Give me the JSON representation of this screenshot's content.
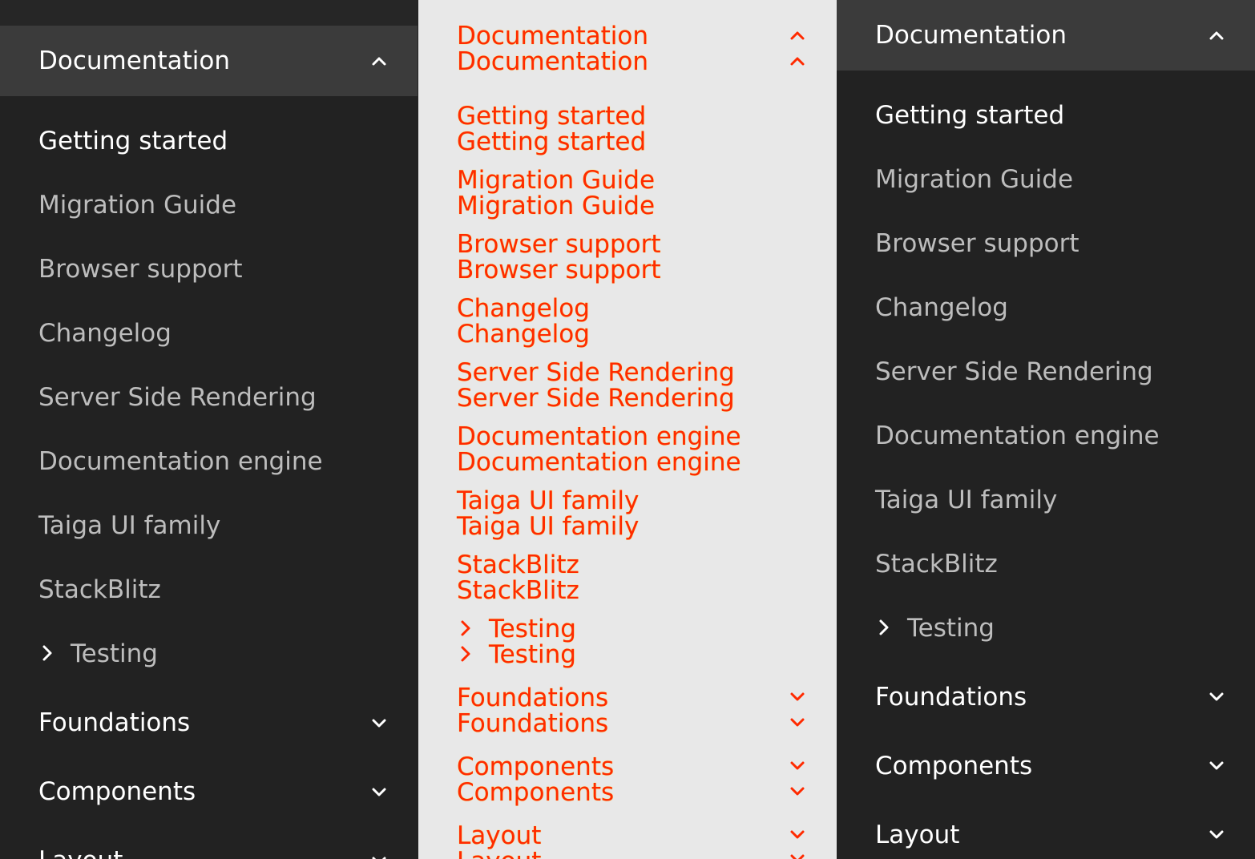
{
  "nav": {
    "documentation": "Documentation",
    "items": [
      "Getting started",
      "Migration Guide",
      "Browser support",
      "Changelog",
      "Server Side Rendering",
      "Documentation engine",
      "Taiga UI family",
      "StackBlitz"
    ],
    "testing": "Testing",
    "foundations": "Foundations",
    "components": "Components",
    "layout": "Layout"
  },
  "icons": {
    "expanded": "chevron-up-icon",
    "collapsed": "chevron-down-icon",
    "subgroup": "chevron-right-icon"
  },
  "colors": {
    "background": "#222222",
    "active_section": "#3b3b3b",
    "text_primary": "#ffffff",
    "text_secondary": "#bdbdbd",
    "overlay_background": "#e8e8e8",
    "overlay_text": "#ff2a00"
  }
}
